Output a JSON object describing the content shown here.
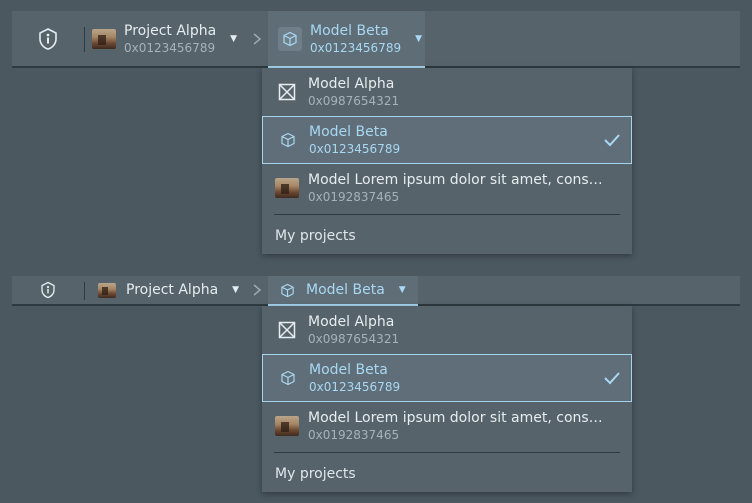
{
  "breadcrumbs": {
    "project": {
      "name": "Project Alpha",
      "id": "0x0123456789"
    },
    "model": {
      "name": "Model Beta",
      "id": "0x0123456789"
    }
  },
  "dropdown": {
    "items": [
      {
        "name": "Model Alpha",
        "id": "0x0987654321",
        "icon": "model-crossed-box-icon",
        "selected": false
      },
      {
        "name": "Model Beta",
        "id": "0x0123456789",
        "icon": "cube-icon",
        "selected": true
      },
      {
        "name": "Model Lorem ipsum dolor sit amet, consecte…",
        "id": "0x0192837465",
        "icon": "model-thumbnail",
        "selected": false
      }
    ],
    "footer_label": "My projects"
  },
  "colors": {
    "background": "#4b5860",
    "bar": "#56636b",
    "accent": "#a5d3ee",
    "accent_text": "#a9d8f3"
  }
}
